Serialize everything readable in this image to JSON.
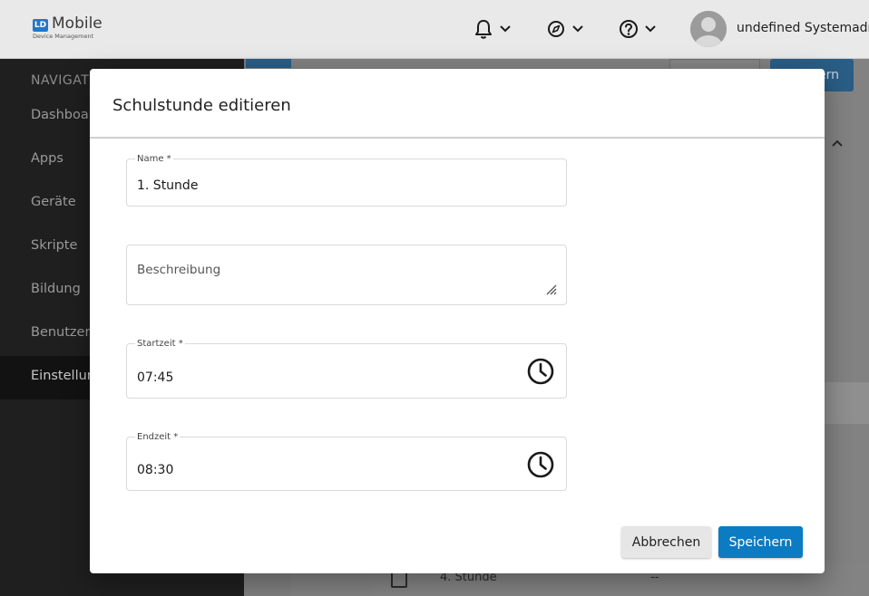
{
  "app": {
    "logo_badge": "LD",
    "logo_title": "Mobile",
    "logo_subtitle": "Device Management"
  },
  "header": {
    "icons": [
      "bell-icon",
      "compass-icon",
      "help-icon"
    ],
    "user_name": "undefined Systemadmi…"
  },
  "sidebar": {
    "heading": "NAVIGATI",
    "items": [
      {
        "label": "Dashboard"
      },
      {
        "label": "Apps"
      },
      {
        "label": "Geräte"
      },
      {
        "label": "Skripte"
      },
      {
        "label": "Bildung"
      },
      {
        "label": "Benutzer"
      },
      {
        "label": "Einstellung"
      }
    ],
    "active_index": 6
  },
  "background": {
    "save_button_fragment": "ern",
    "table_row": {
      "name": "4. Stunde",
      "value": "--"
    }
  },
  "dialog": {
    "title": "Schulstunde editieren",
    "fields": {
      "name": {
        "label": "Name *",
        "value": "1. Stunde"
      },
      "description": {
        "placeholder": "Beschreibung"
      },
      "start": {
        "label": "Startzeit *",
        "value": "07:45"
      },
      "end": {
        "label": "Endzeit *",
        "value": "08:30"
      }
    },
    "cancel_label": "Abbrechen",
    "save_label": "Speichern"
  },
  "colors": {
    "primary": "#0b7bc3",
    "sidebar_bg": "#1f1f1f",
    "overlay": "#7f7f7f"
  }
}
